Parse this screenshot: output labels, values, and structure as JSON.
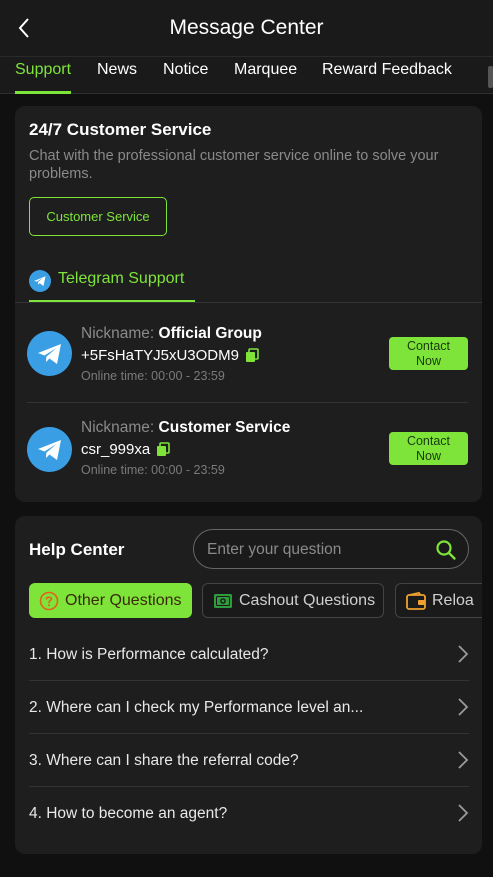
{
  "header": {
    "title": "Message Center"
  },
  "tabs": [
    {
      "label": "Support",
      "active": true
    },
    {
      "label": "News",
      "active": false
    },
    {
      "label": "Notice",
      "active": false
    },
    {
      "label": "Marquee",
      "active": false
    },
    {
      "label": "Reward Feedback",
      "active": false
    }
  ],
  "customer_service": {
    "title": "24/7 Customer Service",
    "description": "Chat with the professional customer service online to solve your problems.",
    "button_label": "Customer Service",
    "channel_tab_label": "Telegram Support",
    "contacts": [
      {
        "nickname_key": "Nickname:",
        "nickname": "Official Group",
        "id": "+5FsHaTYJ5xU3ODM9",
        "online_time": "Online time: 00:00 - 23:59",
        "button_line1": "Contact",
        "button_line2": "Now"
      },
      {
        "nickname_key": "Nickname:",
        "nickname": "Customer Service",
        "id": "csr_999xa",
        "online_time": "Online time: 00:00 - 23:59",
        "button_line1": "Contact",
        "button_line2": "Now"
      }
    ]
  },
  "help_center": {
    "title": "Help Center",
    "search_placeholder": "Enter your question",
    "categories": [
      {
        "label": "Other Questions",
        "icon": "question-circle-icon",
        "active": true
      },
      {
        "label": "Cashout Questions",
        "icon": "cash-icon",
        "active": false
      },
      {
        "label": "Reloa",
        "icon": "wallet-icon",
        "active": false
      }
    ],
    "questions": [
      "1. How is Performance calculated?",
      "2. Where can I check my Performance level an...",
      "3. Where can I share the referral code?",
      "4. How to become an agent?"
    ]
  },
  "colors": {
    "accent": "#7ee43a",
    "background": "#101010",
    "card": "#1e1e1e",
    "telegram_blue": "#3a9ee4"
  }
}
